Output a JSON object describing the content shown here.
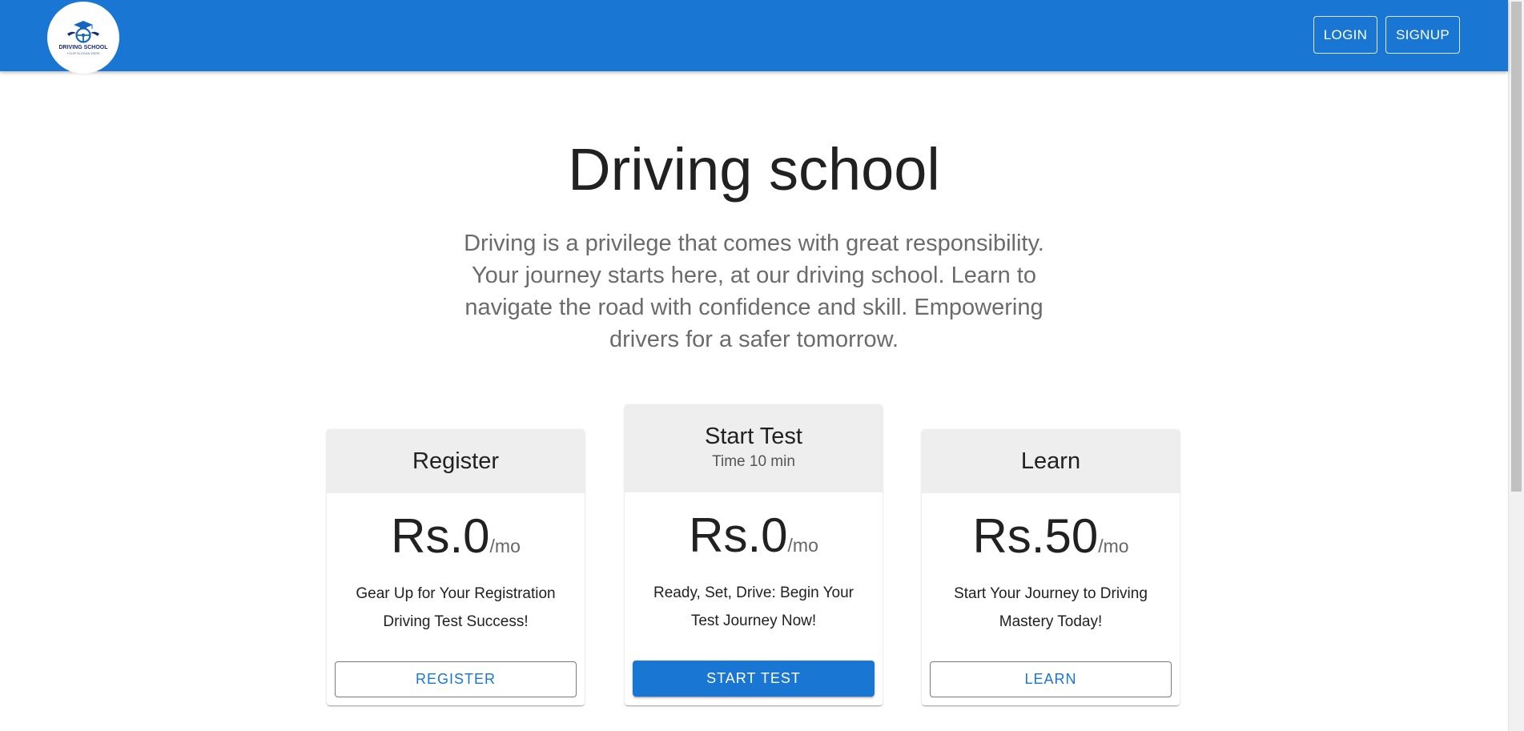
{
  "header": {
    "logo": {
      "text": "DRIVING SCHOOL",
      "subtext": "YOUR SLOGAN HERE",
      "icon": "steering-wheel-icon"
    },
    "login_label": "LOGIN",
    "signup_label": "SIGNUP"
  },
  "hero": {
    "title": "Driving school",
    "description": "Driving is a privilege that comes with great responsibility. Your journey starts here, at our driving school. Learn to navigate the road with confidence and skill. Empowering drivers for a safer tomorrow."
  },
  "cards": [
    {
      "title": "Register",
      "subtitle": "",
      "price": "Rs.0",
      "period": "/mo",
      "description": "Gear Up for Your Registration Driving Test Success!",
      "button_label": "REGISTER",
      "button_style": "outlined"
    },
    {
      "title": "Start Test",
      "subtitle": "Time 10 min",
      "price": "Rs.0",
      "period": "/mo",
      "description": "Ready, Set, Drive: Begin Your Test Journey Now!",
      "button_label": "START TEST",
      "button_style": "contained"
    },
    {
      "title": "Learn",
      "subtitle": "",
      "price": "Rs.50",
      "period": "/mo",
      "description": "Start Your Journey to Driving Mastery Today!",
      "button_label": "LEARN",
      "button_style": "outlined"
    }
  ],
  "colors": {
    "primary": "#1976d2",
    "card_header_bg": "#eeeeee",
    "text_primary": "#212121",
    "text_secondary": "#6b6b6b"
  }
}
